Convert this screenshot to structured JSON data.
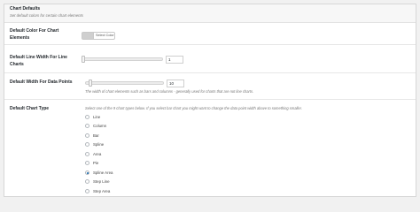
{
  "section": {
    "title": "Chart Defaults",
    "description": "Set default colors for certain chart elements"
  },
  "fields": {
    "default_color": {
      "label": "Default Color For Chart Elements",
      "button_label": "Select Color",
      "swatch_color": "#cfcfcf"
    },
    "line_width": {
      "label": "Default Line Width For Line Charts",
      "value": "1"
    },
    "data_point_width": {
      "label": "Default Width For Data Points",
      "value": "10",
      "description": "The width of chart elements such as bars and columns - generally used for charts that are not line charts."
    },
    "chart_type": {
      "label": "Default Chart Type",
      "description": "Select one of the 9 chart types below. If you select bar chart you might want to change the data point width above to something smaller.",
      "options": [
        "Line",
        "Column",
        "Bar",
        "Spline",
        "Area",
        "Pie",
        "Spline Area",
        "Step Line",
        "Step Area"
      ],
      "selected": "Spline Area"
    }
  },
  "colors": {
    "accent": "#2271b1",
    "background": "#f1f1f1",
    "panel": "#ffffff"
  }
}
